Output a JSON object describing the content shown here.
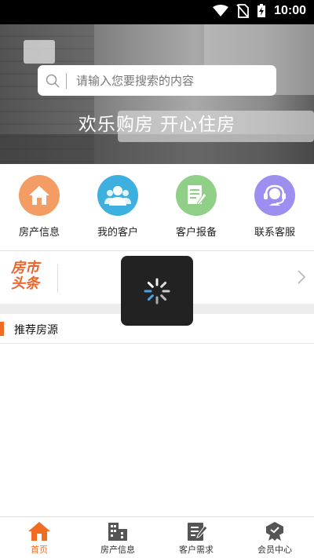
{
  "status_bar": {
    "time": "10:00"
  },
  "hero": {
    "search_placeholder": "请输入您要搜索的内容",
    "slogan": "欢乐购房  开心住房"
  },
  "quick_nav": [
    {
      "label": "房产信息",
      "icon": "house-icon",
      "color": "#f39c63"
    },
    {
      "label": "我的客户",
      "icon": "customers-icon",
      "color": "#3eb0df"
    },
    {
      "label": "客户报备",
      "icon": "report-form-icon",
      "color": "#8fcf88"
    },
    {
      "label": "联系客服",
      "icon": "customer-service-icon",
      "color": "#9c8ff0"
    }
  ],
  "news": {
    "logo_line1": "房市",
    "logo_line2": "头条"
  },
  "section": {
    "title": "推荐房源"
  },
  "tabs": [
    {
      "label": "首页",
      "icon": "home-icon",
      "active": true
    },
    {
      "label": "房产信息",
      "icon": "building-icon",
      "active": false
    },
    {
      "label": "客户需求",
      "icon": "edit-list-icon",
      "active": false
    },
    {
      "label": "会员中心",
      "icon": "member-badge-icon",
      "active": false
    }
  ],
  "colors": {
    "accent": "#ef6c22",
    "tab_inactive": "#555555"
  }
}
